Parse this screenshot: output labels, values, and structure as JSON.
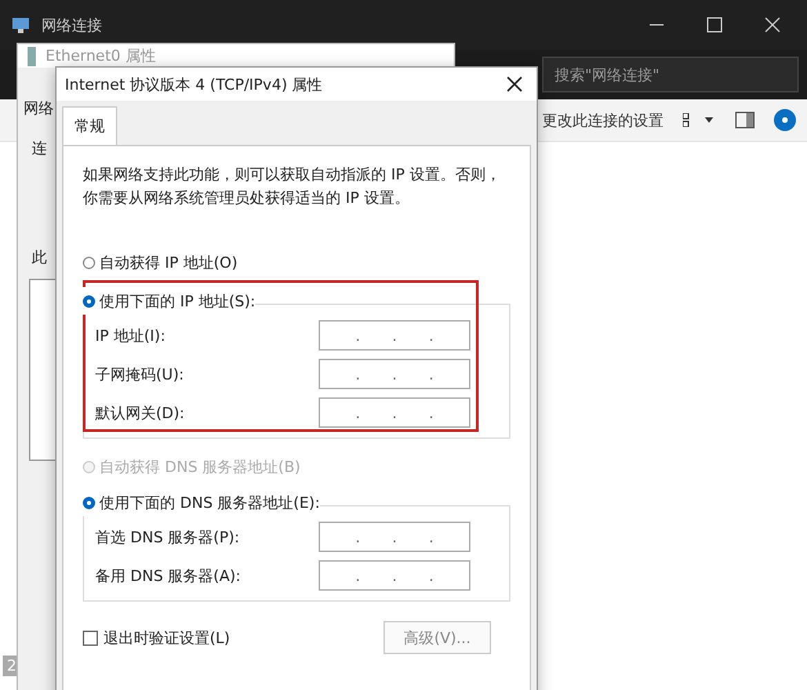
{
  "main_window": {
    "title": "网络连接",
    "search": {
      "placeholder": "搜索\"网络连接\""
    },
    "toolbar": {
      "action": "更改此连接的设置"
    },
    "status": "2"
  },
  "back_dialog": {
    "title": "Ethernet0 属性",
    "tab": "网络",
    "labels": [
      "连",
      "此"
    ]
  },
  "ipv4_dialog": {
    "title": "Internet 协议版本 4 (TCP/IPv4) 属性",
    "tabs": [
      {
        "label": "常规",
        "selected": true
      }
    ],
    "description": "如果网络支持此功能，则可以获取自动指派的 IP 设置。否则，你需要从网络系统管理员处获得适当的 IP 设置。",
    "ip_options": [
      {
        "label": "自动获得 IP 地址(O)",
        "selected": false,
        "disabled": false
      },
      {
        "label": "使用下面的 IP 地址(S):",
        "selected": true,
        "disabled": false
      }
    ],
    "ip_fields": [
      {
        "label": "IP 地址(I):",
        "separator": "."
      },
      {
        "label": "子网掩码(U):",
        "separator": "."
      },
      {
        "label": "默认网关(D):",
        "separator": "."
      }
    ],
    "dns_options": [
      {
        "label": "自动获得 DNS 服务器地址(B)",
        "selected": false,
        "disabled": true
      },
      {
        "label": "使用下面的 DNS 服务器地址(E):",
        "selected": true,
        "disabled": false
      }
    ],
    "dns_fields": [
      {
        "label": "首选 DNS 服务器(P):",
        "separator": "."
      },
      {
        "label": "备用 DNS 服务器(A):",
        "separator": "."
      }
    ],
    "validate": {
      "label": "退出时验证设置(L)",
      "checked": false
    },
    "advanced_button": "高级(V)..."
  }
}
